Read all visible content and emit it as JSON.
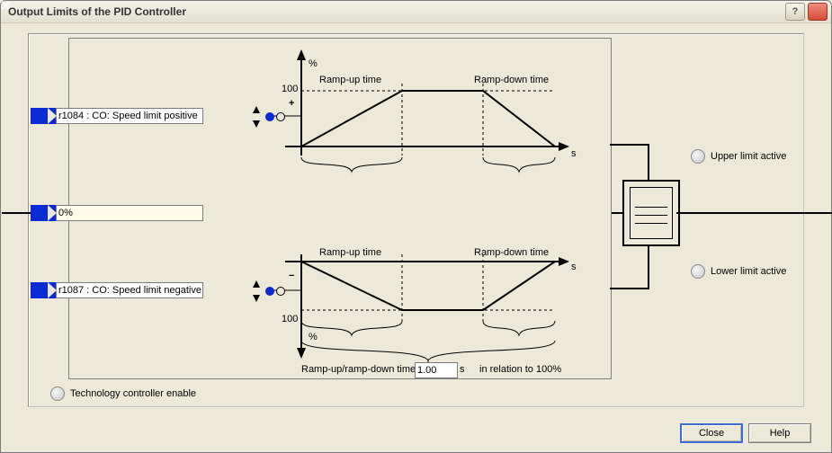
{
  "window": {
    "title": "Output Limits of the PID Controller"
  },
  "params": {
    "posLimit": "r1084 : CO: Speed limit positive",
    "center": "0%",
    "negLimit": "r1087 : CO: Speed limit negative"
  },
  "labels": {
    "percent": "%",
    "hundred": "100",
    "rampUp": "Ramp-up time",
    "rampDown": "Ramp-down time",
    "sAxis": "s",
    "rampBoth": "Ramp-up/ramp-down time",
    "relation": "in relation to 100%"
  },
  "inputs": {
    "rampTime": "1.00",
    "rampUnit": "s"
  },
  "status": {
    "upper": "Upper limit active",
    "lower": "Lower limit active",
    "techEnable": "Technology controller enable"
  },
  "buttons": {
    "close": "Close",
    "help": "Help"
  }
}
